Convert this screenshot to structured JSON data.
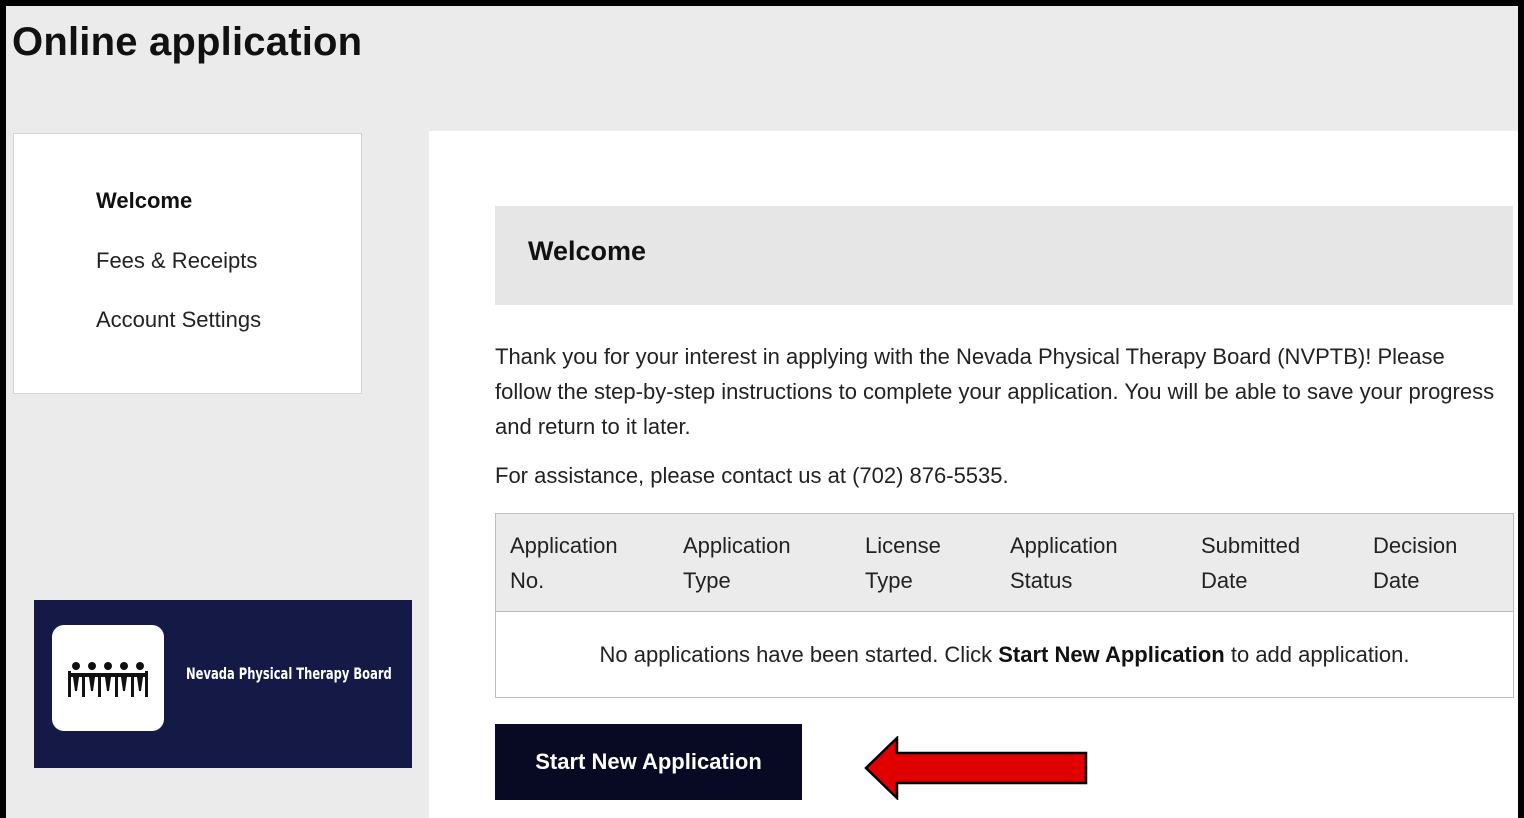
{
  "page": {
    "title": "Online application"
  },
  "sidebar": {
    "items": [
      {
        "label": "Welcome",
        "active": true
      },
      {
        "label": "Fees & Receipts",
        "active": false
      },
      {
        "label": "Account Settings",
        "active": false
      }
    ]
  },
  "logo": {
    "text": "Nevada Physical Therapy Board",
    "icon": "board-meeting-icon",
    "background_color": "#141a45"
  },
  "main": {
    "section_title": "Welcome",
    "intro_text": "Thank you for your interest in applying with the Nevada Physical Therapy Board (NVPTB)! Please follow the step-by-step instructions to complete your application. You will be able to save your progress and return to it later.",
    "assistance_text": "For assistance, please contact us at (702) 876-5535.",
    "table": {
      "columns": [
        [
          "Application",
          "No."
        ],
        [
          "Application",
          "Type"
        ],
        [
          "License",
          "Type"
        ],
        [
          "Application",
          "Status"
        ],
        [
          "Submitted",
          "Date"
        ],
        [
          "Decision",
          "Date"
        ]
      ],
      "empty_message": {
        "before": "No applications have been started. Click ",
        "bold": "Start New Application",
        "after": " to add application."
      }
    },
    "start_button_label": "Start New Application"
  },
  "annotation": {
    "icon": "red-arrow-left-icon",
    "color": "#e00000"
  }
}
